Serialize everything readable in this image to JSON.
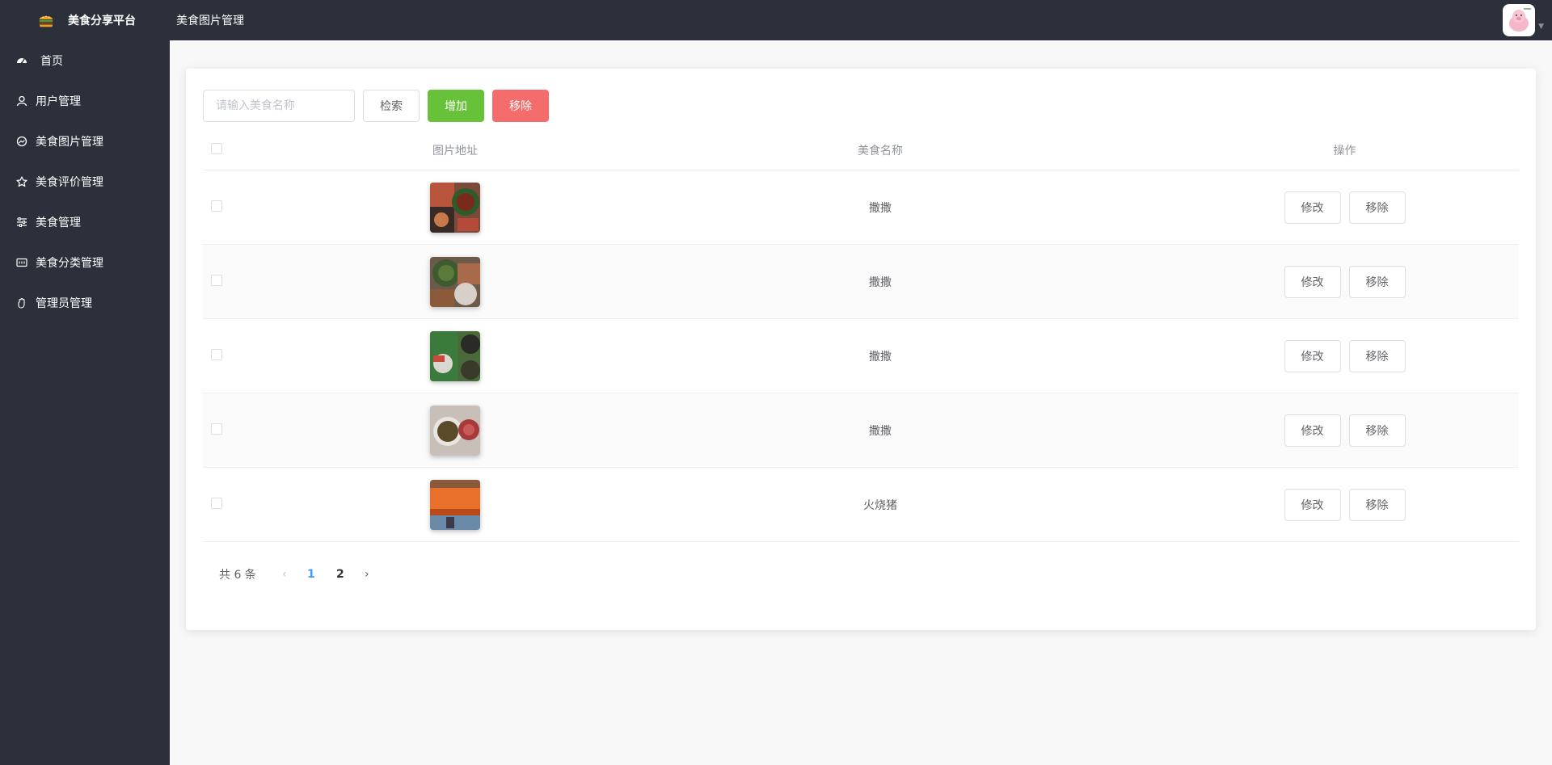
{
  "header": {
    "brand": "美食分享平台",
    "page_title": "美食图片管理"
  },
  "sidebar": {
    "items": [
      {
        "label": "首页",
        "icon": "dashboard-icon"
      },
      {
        "label": "用户管理",
        "icon": "user-icon"
      },
      {
        "label": "美食图片管理",
        "icon": "picture-icon"
      },
      {
        "label": "美食评价管理",
        "icon": "star-icon"
      },
      {
        "label": "美食管理",
        "icon": "sliders-icon"
      },
      {
        "label": "美食分类管理",
        "icon": "category-icon"
      },
      {
        "label": "管理员管理",
        "icon": "hand-icon"
      }
    ]
  },
  "toolbar": {
    "search_placeholder": "请输入美食名称",
    "search_label": "检索",
    "add_label": "增加",
    "remove_label": "移除"
  },
  "table": {
    "columns": [
      "图片地址",
      "美食名称",
      "操作"
    ],
    "rows": [
      {
        "name": "撒撒",
        "edit_label": "修改",
        "remove_label": "移除"
      },
      {
        "name": "撒撒",
        "edit_label": "修改",
        "remove_label": "移除"
      },
      {
        "name": "撒撒",
        "edit_label": "修改",
        "remove_label": "移除"
      },
      {
        "name": "撒撒",
        "edit_label": "修改",
        "remove_label": "移除"
      },
      {
        "name": "火烧猪",
        "edit_label": "修改",
        "remove_label": "移除"
      }
    ]
  },
  "pagination": {
    "total_label": "共 6 条",
    "pages": [
      "1",
      "2"
    ],
    "current": "1"
  }
}
